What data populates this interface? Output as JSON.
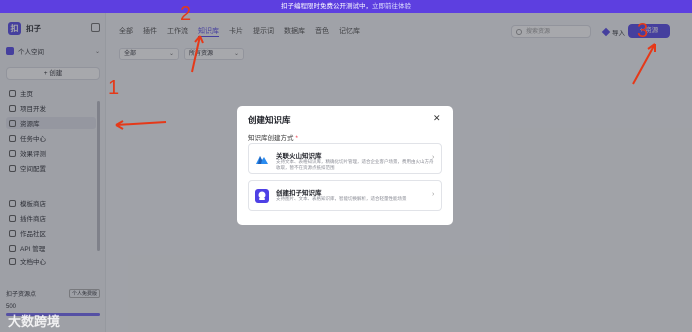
{
  "banner": {
    "text": "扣子编程限时免费公开测试中，",
    "link": "立即前往体验"
  },
  "app": {
    "name": "扣子",
    "logo_char": "扣"
  },
  "sidebar": {
    "space": "个人空间",
    "create": "+ 创建",
    "items": [
      {
        "label": "主页"
      },
      {
        "label": "项目开发"
      },
      {
        "label": "资源库"
      },
      {
        "label": "任务中心"
      },
      {
        "label": "效果评测"
      },
      {
        "label": "空间配置"
      },
      {
        "label": "模板商店"
      },
      {
        "label": "插件商店"
      },
      {
        "label": "作品社区"
      },
      {
        "label": "API 管理"
      },
      {
        "label": "文档中心"
      }
    ],
    "points": {
      "title": "扣子资源点",
      "tag": "个人免费版",
      "num": "500",
      "fill": 1.0
    }
  },
  "content": {
    "tabs": [
      "全部",
      "插件",
      "工作流",
      "知识库",
      "卡片",
      "提示词",
      "数据库",
      "音色",
      "记忆库"
    ],
    "active_tab": "知识库",
    "search_placeholder": "搜索资源",
    "import_label": "导入",
    "resource_btn": "+ 资源",
    "filter1": "全部",
    "filter2": "所有资源"
  },
  "modal": {
    "title": "创建知识库",
    "close": "✕",
    "label": "知识库创建方式",
    "required": "*",
    "options": [
      {
        "title": "关联火山知识库",
        "desc": "支持文本、表格知识库，精确化切片管理，适合企业客户场景，费用由火山方舟收取，暂不在资源点抵扣范围",
        "arrow": "›"
      },
      {
        "title": "创建扣子知识库",
        "desc": "支持图片、文本、表格知识库，智能切换解析，适合轻量性能场景",
        "arrow": "›"
      }
    ]
  },
  "annotations": {
    "n1": "1",
    "n2": "2",
    "n3": "3"
  },
  "watermark": "大数跨境",
  "colors": {
    "accent": "#4e40e5",
    "annotation": "#e53919"
  }
}
